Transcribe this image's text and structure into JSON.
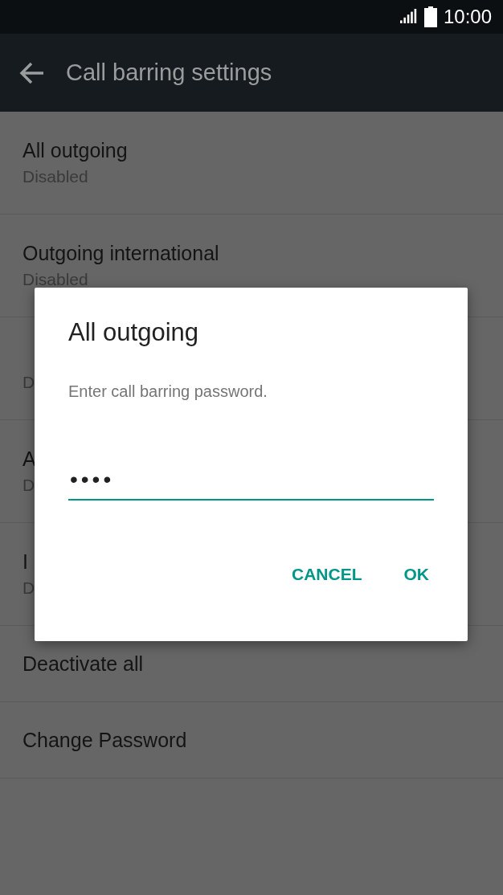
{
  "status_bar": {
    "time": "10:00"
  },
  "app_bar": {
    "title": "Call barring settings"
  },
  "items": [
    {
      "title": "All outgoing",
      "subtitle": "Disabled"
    },
    {
      "title": "Outgoing international",
      "subtitle": "Disabled"
    },
    {
      "subtitle": "D"
    },
    {
      "title": "A",
      "subtitle": "D"
    },
    {
      "title": "I",
      "subtitle": "D"
    },
    {
      "title": "Deactivate all"
    },
    {
      "title": "Change Password"
    }
  ],
  "dialog": {
    "title": "All outgoing",
    "message": "Enter call barring password.",
    "password": "••••",
    "buttons": [
      "CANCEL",
      "OK"
    ]
  }
}
